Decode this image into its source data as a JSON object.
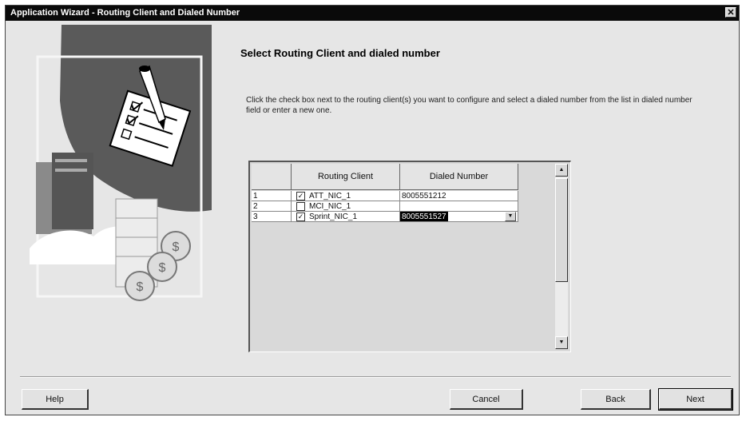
{
  "window": {
    "title": "Application Wizard - Routing Client and Dialed Number",
    "close_glyph": "✕"
  },
  "page": {
    "heading": "Select Routing Client and dialed number",
    "instructions": "Click the check box next to the routing client(s) you want to configure and select a dialed number from the list in dialed number field or enter a new one."
  },
  "grid": {
    "columns": {
      "routing_client": "Routing Client",
      "dialed_number": "Dialed Number"
    },
    "rows": [
      {
        "index": "1",
        "checked": true,
        "routing_client": "ATT_NIC_1",
        "dialed_number": "8005551212",
        "selected": false
      },
      {
        "index": "2",
        "checked": false,
        "routing_client": "MCI_NIC_1",
        "dialed_number": "",
        "selected": false
      },
      {
        "index": "3",
        "checked": true,
        "routing_client": "Sprint_NIC_1",
        "dialed_number": "8005551527",
        "selected": true
      }
    ],
    "check_glyph": "✓"
  },
  "buttons": {
    "help": "Help",
    "cancel": "Cancel",
    "back": "Back",
    "next": "Next"
  },
  "icons": {
    "illustration": "wizard-checklist-illustration",
    "scroll_up": "scroll-up-arrow-icon",
    "scroll_down": "scroll-down-arrow-icon",
    "dropdown": "dropdown-arrow-icon"
  }
}
